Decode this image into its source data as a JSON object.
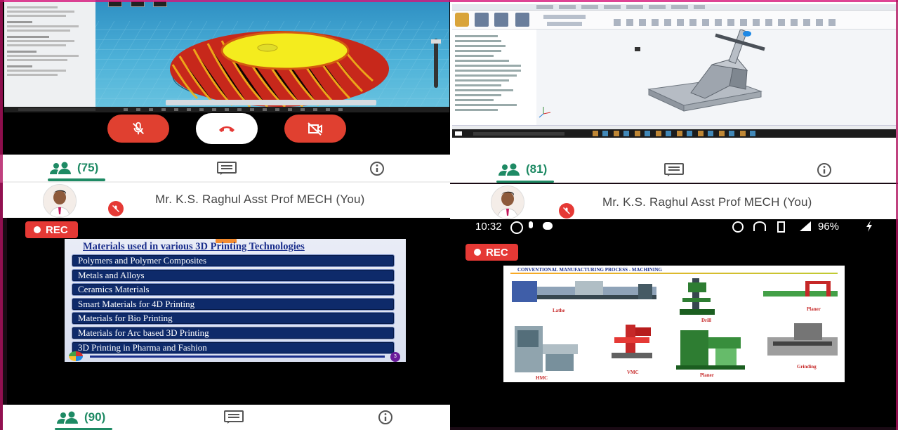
{
  "top_left": {
    "call_controls": {
      "mic_label": "mic-off",
      "end_label": "end-call",
      "cam_label": "camera-off"
    },
    "tabs": {
      "participants_count": "(75)"
    },
    "user": {
      "name": "Mr. K.S. Raghul Asst Prof MECH (You)"
    }
  },
  "top_right": {
    "tabs": {
      "participants_count": "(81)"
    },
    "user": {
      "name": "Mr. K.S. Raghul Asst Prof MECH (You)"
    }
  },
  "bottom_left": {
    "rec_label": "REC",
    "slide": {
      "title": "Materials used in various 3D Printing Technologies",
      "items": [
        "Polymers and Polymer Composites",
        "Metals and Alloys",
        "Ceramics Materials",
        "Smart Materials for 4D Printing",
        "Materials for Bio Printing",
        "Materials for Arc based 3D Printing",
        "3D Printing in Pharma and Fashion"
      ],
      "page": "3"
    },
    "tabs": {
      "participants_count": "(90)"
    }
  },
  "bottom_right": {
    "status_bar": {
      "time": "10:32",
      "battery": "96%"
    },
    "rec_label": "REC",
    "slide": {
      "title": "CONVENTIONAL MANUFACTURING PROCESS - MACHINING",
      "captions": [
        "Lathe",
        "Drill",
        "Planer",
        "HMC",
        "VMC",
        "Planer",
        "Grinding"
      ]
    }
  },
  "colors": {
    "rec": "#e53935",
    "teal": "#1e8a64",
    "navy": "#0e2a6a",
    "hot_pink_border": "#d6157a"
  }
}
